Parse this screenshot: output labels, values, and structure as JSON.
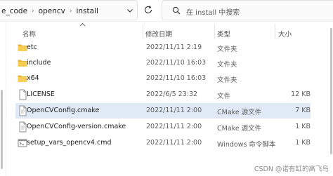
{
  "address_bar": {
    "crumbs": [
      "e_code",
      "opencv",
      "install"
    ],
    "separator": "›"
  },
  "search": {
    "placeholder": "在 install 中搜索"
  },
  "columns": {
    "name": "名称",
    "modified": "修改日期",
    "type": "类型",
    "size": "大小"
  },
  "files": [
    {
      "name": "etc",
      "modified": "2022/11/11 2:19",
      "type": "文件夹",
      "size": "",
      "icon": "folder-icon"
    },
    {
      "name": "include",
      "modified": "2022/11/10 16:03",
      "type": "文件夹",
      "size": "",
      "icon": "folder-icon"
    },
    {
      "name": "x64",
      "modified": "2022/11/10 16:03",
      "type": "文件夹",
      "size": "",
      "icon": "folder-icon"
    },
    {
      "name": "LICENSE",
      "modified": "2022/6/5 23:32",
      "type": "文件",
      "size": "12 KB",
      "icon": "file-icon"
    },
    {
      "name": "OpenCVConfig.cmake",
      "modified": "2022/11/11 2:00",
      "type": "CMake 源文件",
      "size": "7 KB",
      "icon": "cmake-file-icon"
    },
    {
      "name": "OpenCVConfig-version.cmake",
      "modified": "2022/11/11 2:00",
      "type": "CMake 源文件",
      "size": "1 KB",
      "icon": "cmake-file-icon"
    },
    {
      "name": "setup_vars_opencv4.cmd",
      "modified": "2022/11/11 2:00",
      "type": "Windows 命令脚本",
      "size": "1 KB",
      "icon": "cmd-script-icon"
    }
  ],
  "watermark": "CSDN @诺有缸的高飞鸟",
  "colors": {
    "folder": "#f4c542",
    "selection": "#dfeaf6"
  }
}
